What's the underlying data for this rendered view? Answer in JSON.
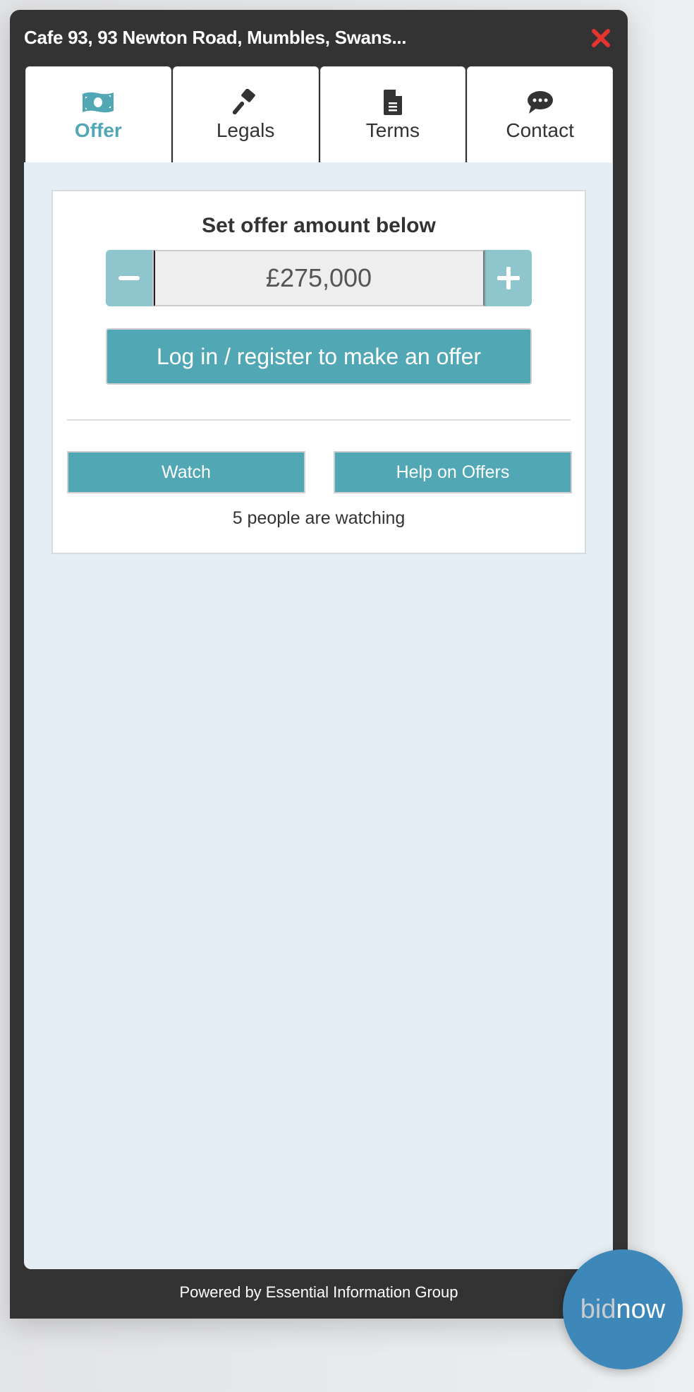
{
  "header": {
    "title": "Cafe 93, 93 Newton Road, Mumbles, Swans...",
    "close_icon": "close-x-icon",
    "close_color": "#e3342f"
  },
  "tabs": [
    {
      "label": "Offer",
      "icon": "money-bill-icon",
      "active": true
    },
    {
      "label": "Legals",
      "icon": "gavel-icon",
      "active": false
    },
    {
      "label": "Terms",
      "icon": "document-icon",
      "active": false
    },
    {
      "label": "Contact",
      "icon": "chat-bubble-icon",
      "active": false
    }
  ],
  "offer": {
    "heading": "Set offer amount below",
    "amount": "£275,000",
    "decrement_icon": "minus-icon",
    "increment_icon": "plus-icon",
    "login_button": "Log in / register to make an offer",
    "watch_button": "Watch",
    "help_button": "Help on Offers",
    "watching_text": "5 people are watching"
  },
  "footer": {
    "powered_by": "Powered by Essential Information Group"
  },
  "badge": {
    "part1": "bid",
    "part2": "now"
  },
  "colors": {
    "accent": "#52a7b5",
    "stepper": "#8fc6cd",
    "panel": "#333333",
    "content_bg": "#e5edf5",
    "badge": "#3e88b9"
  }
}
